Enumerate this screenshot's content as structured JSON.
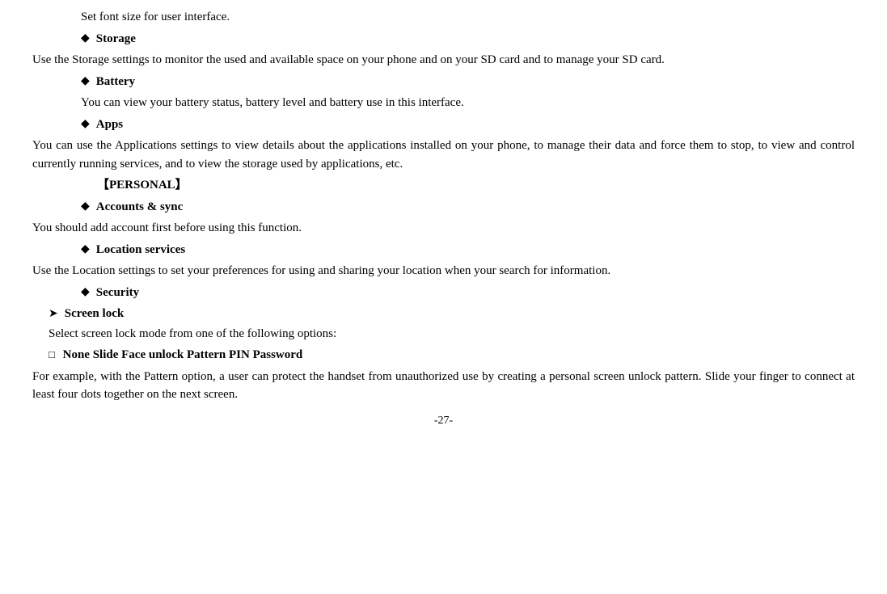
{
  "intro_text": "Set font size for user interface.",
  "storage": {
    "heading": "Storage",
    "body": "Use the Storage settings to monitor the used and available space on your phone and on your SD card and to manage your SD card."
  },
  "battery": {
    "heading": "Battery",
    "body": "You can view your battery status, battery level and battery use in this interface."
  },
  "apps": {
    "heading": "Apps",
    "body": "You can use the Applications settings to view details about the applications installed on your phone, to manage their data and force them to stop, to view and control currently running services, and to view the storage used by applications, etc."
  },
  "personal_bracket": "【PERSONAL】",
  "accounts_sync": {
    "heading": "Accounts & sync",
    "body": "You should add account first before using this function."
  },
  "location_services": {
    "heading": "Location services",
    "body": "Use the Location settings to set your preferences for using and sharing your location when your search for information."
  },
  "security": {
    "heading": "Security"
  },
  "screen_lock": {
    "heading": "Screen lock",
    "body": "Select screen lock mode from one of the following options:"
  },
  "options": {
    "prefix": "□",
    "items": "None   Slide    Face unlock     Pattern     PIN    Password"
  },
  "final_body": "For example, with the Pattern option, a user can protect the handset from unauthorized use by creating a personal screen unlock pattern. Slide your finger to connect at least four dots together on the next screen.",
  "page_number": "-27-"
}
